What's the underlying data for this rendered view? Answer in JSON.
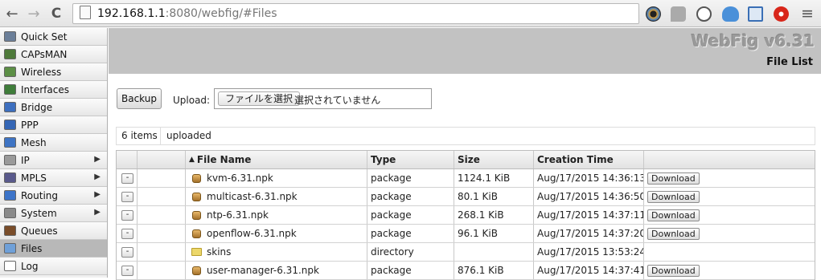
{
  "browser": {
    "url_host": "192.168.1.1",
    "url_rest": ":8080/webfig/#Files",
    "back_glyph": "←",
    "forward_glyph": "→",
    "reload_glyph": "C",
    "menu_glyph": "≡"
  },
  "header": {
    "brand": "WebFig v6.31",
    "page_title": "File List"
  },
  "sidebar": {
    "items": [
      {
        "label": "Quick Set",
        "icon": "wrench-icon",
        "color": "#6b7f99",
        "submenu": false,
        "active": false
      },
      {
        "label": "CAPsMAN",
        "icon": "antenna-icon",
        "color": "#4e7a3a",
        "submenu": false,
        "active": false
      },
      {
        "label": "Wireless",
        "icon": "wireless-icon",
        "color": "#5c8f46",
        "submenu": false,
        "active": false
      },
      {
        "label": "Interfaces",
        "icon": "interface-card-icon",
        "color": "#3f7d3a",
        "submenu": false,
        "active": false
      },
      {
        "label": "Bridge",
        "icon": "bridge-icon",
        "color": "#3d6fbf",
        "submenu": false,
        "active": false
      },
      {
        "label": "PPP",
        "icon": "ppp-icon",
        "color": "#3466b5",
        "submenu": false,
        "active": false
      },
      {
        "label": "Mesh",
        "icon": "mesh-icon",
        "color": "#3e74c4",
        "submenu": false,
        "active": false
      },
      {
        "label": "IP",
        "icon": "ip-icon",
        "color": "#9a9a9a",
        "submenu": true,
        "active": false
      },
      {
        "label": "MPLS",
        "icon": "mpls-icon",
        "color": "#5a5a8c",
        "submenu": true,
        "active": false
      },
      {
        "label": "Routing",
        "icon": "routing-icon",
        "color": "#3c74c9",
        "submenu": true,
        "active": false
      },
      {
        "label": "System",
        "icon": "gear-icon",
        "color": "#8a8a8a",
        "submenu": true,
        "active": false
      },
      {
        "label": "Queues",
        "icon": "queues-icon",
        "color": "#7a4d2a",
        "submenu": false,
        "active": false
      },
      {
        "label": "Files",
        "icon": "folder-icon",
        "color": "#6fa0d8",
        "submenu": false,
        "active": true
      },
      {
        "label": "Log",
        "icon": "log-icon",
        "color": "#ffffff",
        "submenu": false,
        "active": false
      }
    ]
  },
  "toolbar": {
    "backup_label": "Backup",
    "upload_label": "Upload:",
    "choose_file_label": "ファイルを選択",
    "no_file_text": "選択されていません"
  },
  "info": {
    "count": "6 items",
    "filter": "uploaded"
  },
  "table": {
    "columns": [
      "File Name",
      "Type",
      "Size",
      "Creation Time"
    ],
    "sort_glyph": "▲",
    "remove_glyph": "-",
    "download_label": "Download",
    "rows": [
      {
        "name": "kvm-6.31.npk",
        "type": "package",
        "size": "1124.1 KiB",
        "time": "Aug/17/2015 14:36:13",
        "kind": "package",
        "download": true
      },
      {
        "name": "multicast-6.31.npk",
        "type": "package",
        "size": "80.1 KiB",
        "time": "Aug/17/2015 14:36:50",
        "kind": "package",
        "download": true
      },
      {
        "name": "ntp-6.31.npk",
        "type": "package",
        "size": "268.1 KiB",
        "time": "Aug/17/2015 14:37:11",
        "kind": "package",
        "download": true
      },
      {
        "name": "openflow-6.31.npk",
        "type": "package",
        "size": "96.1 KiB",
        "time": "Aug/17/2015 14:37:20",
        "kind": "package",
        "download": true
      },
      {
        "name": "skins",
        "type": "directory",
        "size": "",
        "time": "Aug/17/2015 13:53:24",
        "kind": "directory",
        "download": false
      },
      {
        "name": "user-manager-6.31.npk",
        "type": "package",
        "size": "876.1 KiB",
        "time": "Aug/17/2015 14:37:41",
        "kind": "package",
        "download": true
      }
    ]
  }
}
